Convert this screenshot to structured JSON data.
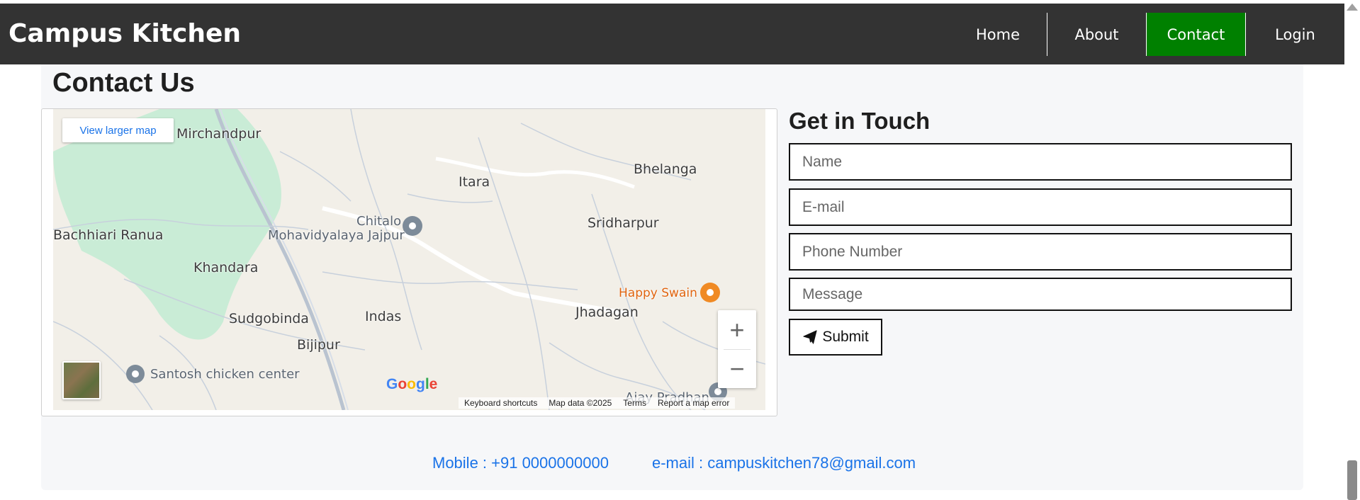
{
  "brand": "Campus Kitchen",
  "nav": [
    {
      "label": "Home",
      "active": false
    },
    {
      "label": "About",
      "active": false
    },
    {
      "label": "Contact",
      "active": true
    },
    {
      "label": "Login",
      "active": false
    }
  ],
  "page_title": "Contact Us",
  "map": {
    "view_larger": "View larger map",
    "places": {
      "mirchandpur": "Mirchandpur",
      "itara": "Itara",
      "bhelanga": "Bhelanga",
      "chitalo": "Chitalo",
      "mohavidyalaya": "Mohavidyalaya Jajpur",
      "bachhiari": "Bachhiari Ranua",
      "sridharpur": "Sridharpur",
      "khandara": "Khandara",
      "happy_swain": "Happy Swain",
      "jhadagan": "Jhadagan",
      "sudgobinda": "Sudgobinda",
      "indas": "Indas",
      "bijipur": "Bijipur",
      "santosh": "Santosh chicken center",
      "ajay": "Ajay Pradhan"
    },
    "zoom_in": "+",
    "zoom_out": "−",
    "google": "Google",
    "footer": {
      "keyboard": "Keyboard shortcuts",
      "map_data": "Map data ©2025",
      "terms": "Terms",
      "report": "Report a map error"
    }
  },
  "form": {
    "title": "Get in Touch",
    "name_placeholder": "Name",
    "email_placeholder": "E-mail",
    "phone_placeholder": "Phone Number",
    "message_placeholder": "Message",
    "submit_label": "Submit"
  },
  "footer": {
    "mobile": "Mobile : +91 0000000000",
    "email": "e-mail : campuskitchen78@gmail.com"
  },
  "colors": {
    "navbar": "#333333",
    "active_nav": "#008000",
    "link": "#1a73e8",
    "panel": "#f6f7f9"
  }
}
